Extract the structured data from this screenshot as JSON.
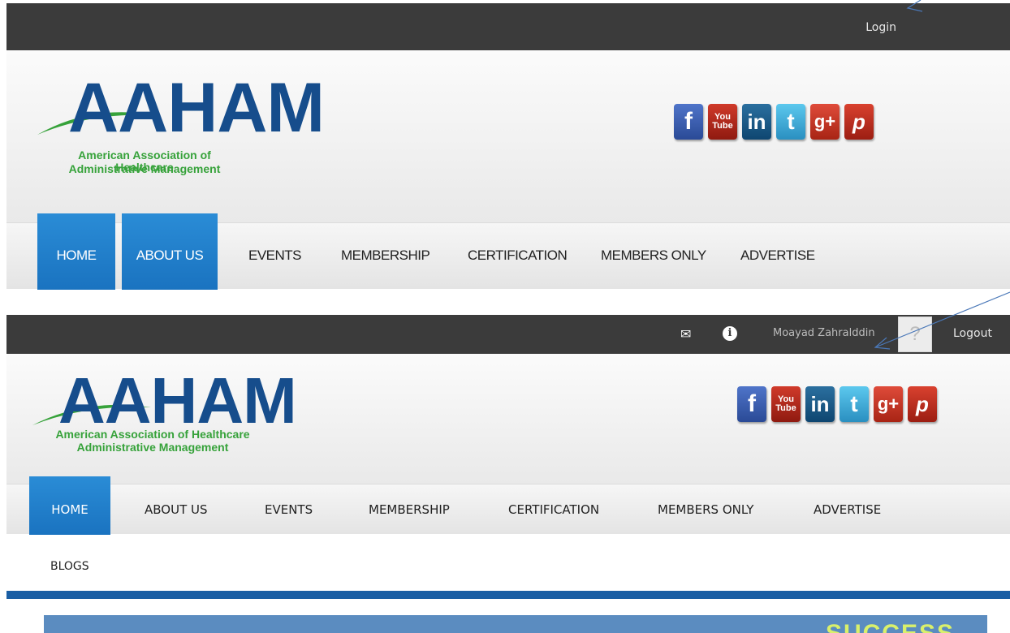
{
  "version_a": {
    "topbar": {
      "login_label": "Login"
    },
    "logo": {
      "wordmark": "AAHAM",
      "tagline_line1": "American Association of Healthcare",
      "tagline_line2": "Administrative Management"
    },
    "social": [
      "facebook-icon",
      "youtube-icon",
      "linkedin-icon",
      "tumblr-icon",
      "google-plus-icon",
      "pinterest-icon"
    ],
    "nav": {
      "items": [
        "HOME",
        "ABOUT US",
        "EVENTS",
        "MEMBERSHIP",
        "CERTIFICATION",
        "MEMBERS ONLY",
        "ADVERTISE"
      ],
      "active": [
        "HOME",
        "ABOUT US"
      ]
    }
  },
  "version_b": {
    "topbar": {
      "messages_icon": "envelope-icon",
      "notifications_icon": "info-icon",
      "user_name": "Moayad Zahralddin",
      "logout_label": "Logout"
    },
    "logo": {
      "wordmark": "AAHAM",
      "tagline_line1": "American Association of Healthcare",
      "tagline_line2": "Administrative Management"
    },
    "nav": {
      "items": [
        "HOME",
        "ABOUT US",
        "EVENTS",
        "MEMBERSHIP",
        "CERTIFICATION",
        "MEMBERS ONLY",
        "ADVERTISE"
      ],
      "active": "HOME",
      "overflow_item": "BLOGS"
    },
    "banner_text": "SUCCESS"
  },
  "social_labels": {
    "facebook": "f",
    "youtube_top": "You",
    "youtube_bottom": "Tube",
    "linkedin": "in",
    "tumblr": "t",
    "googleplus": "g+",
    "pinterest": "p"
  },
  "colors": {
    "topbar": "#3b3b3b",
    "nav_active": "#1f7fcc",
    "logo_blue": "#164d8c",
    "logo_green": "#36a23a",
    "divider": "#1a5ea4"
  }
}
